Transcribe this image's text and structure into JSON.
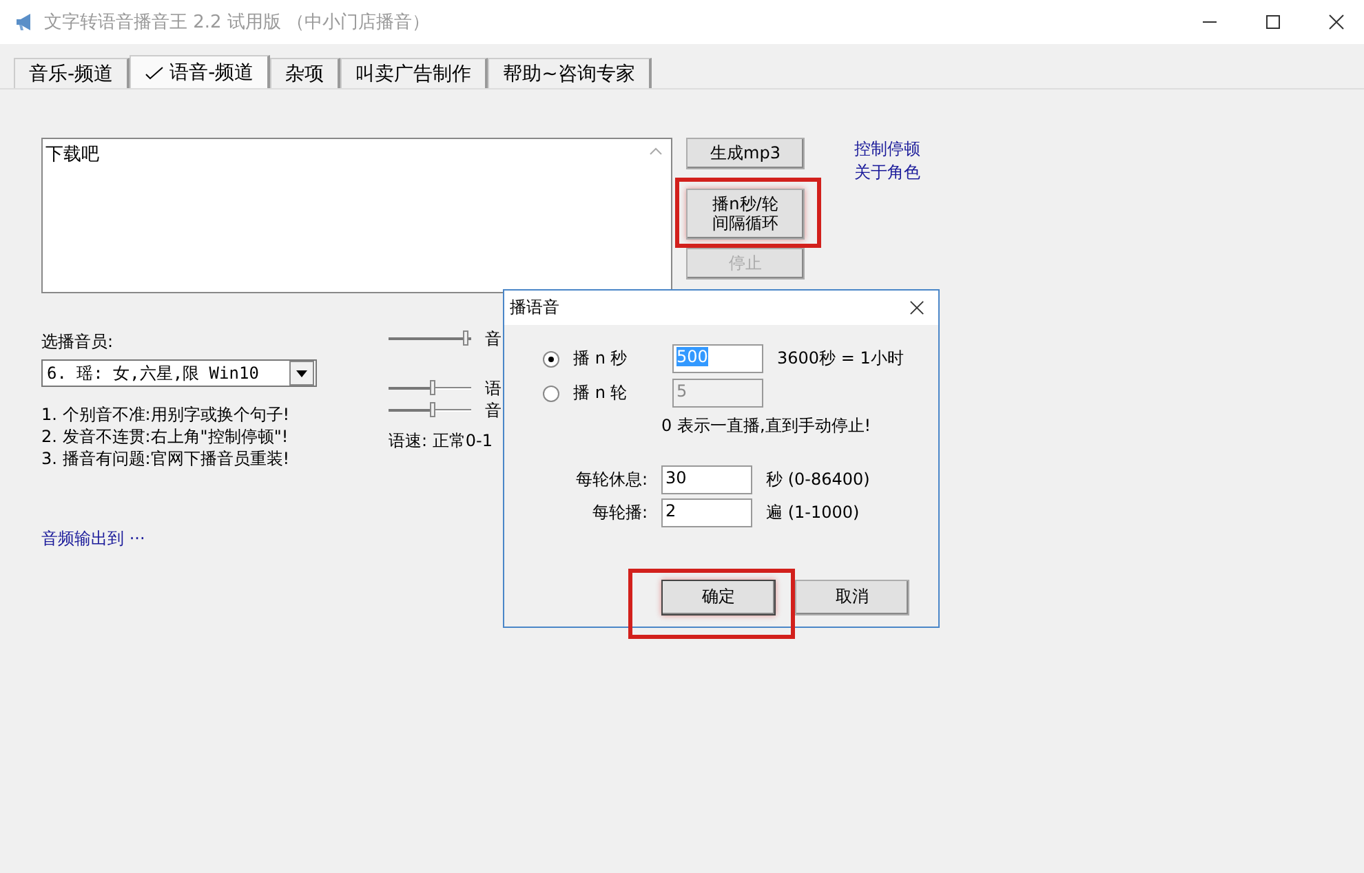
{
  "window": {
    "title": "文字转语音播音王 2.2 试用版 （中小门店播音）"
  },
  "tabs": [
    {
      "label": "音乐-频道",
      "selected": false,
      "checked": false
    },
    {
      "label": "语音-频道",
      "selected": true,
      "checked": true
    },
    {
      "label": "杂项",
      "selected": false,
      "checked": false
    },
    {
      "label": "叫卖广告制作",
      "selected": false,
      "checked": false
    },
    {
      "label": "帮助~咨询专家",
      "selected": false,
      "checked": false
    }
  ],
  "text_area": {
    "value": "下载吧"
  },
  "buttons": [
    {
      "label_lines": [
        "生成mp3"
      ],
      "disabled": false,
      "highlighted": false
    },
    {
      "label_lines": [
        "播n秒/轮",
        "间隔循环"
      ],
      "disabled": false,
      "highlighted": true
    },
    {
      "label_lines": [
        "停止"
      ],
      "disabled": true,
      "highlighted": false
    }
  ],
  "links": [
    "控制停顿",
    "关于角色"
  ],
  "announcer": {
    "label": "选播音员:",
    "value": "6. 瑶: 女,六星,限 Win10"
  },
  "notes": [
    "1. 个别音不准:用别字或换个句子!",
    "2. 发音不连贯:右上角\"控制停顿\"!",
    "3. 播音有问题:官网下播音员重装!"
  ],
  "output_link": "音频输出到 ···",
  "sliders": [
    {
      "level": 1.0,
      "label": "音"
    },
    {
      "level": 0.55,
      "label": "语"
    },
    {
      "level": 0.55,
      "label": "音"
    }
  ],
  "speed_note": "语速: 正常0-1",
  "dialog": {
    "title": "播语音",
    "modes": [
      {
        "label": "播 n 秒",
        "selected": true,
        "value": "500",
        "disabled": false,
        "hint": "3600秒 = 1小时"
      },
      {
        "label": "播 n 轮",
        "selected": false,
        "value": "5",
        "disabled": true
      }
    ],
    "note": "0 表示一直播,直到手动停止!",
    "fields": [
      {
        "label": "每轮休息:",
        "value": "30",
        "unit": "秒 (0-86400)"
      },
      {
        "label": "每轮播:",
        "value": "2",
        "unit": "遍 (1-1000)"
      }
    ],
    "buttons": [
      {
        "label": "确定",
        "highlighted": true
      },
      {
        "label": "取消",
        "highlighted": false
      }
    ]
  }
}
